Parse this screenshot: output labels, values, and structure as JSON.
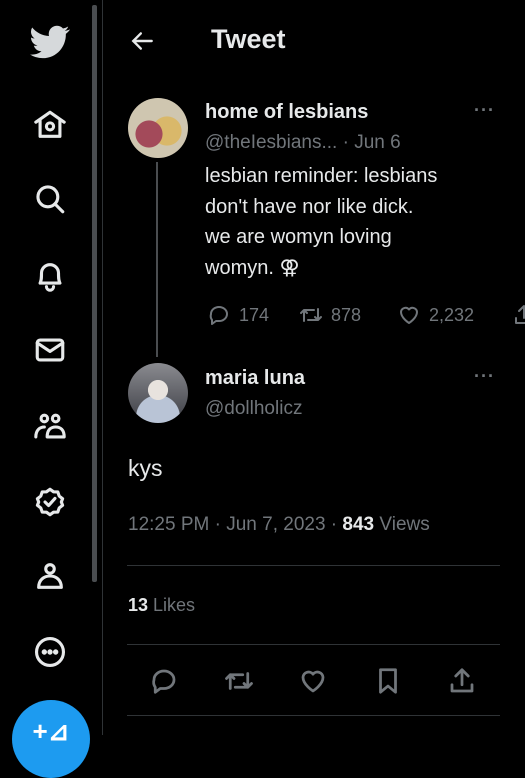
{
  "header": {
    "title": "Tweet"
  },
  "sidebar": {
    "items": [
      "twitter-logo",
      "home",
      "explore",
      "notifications",
      "messages",
      "communities",
      "verified",
      "profile",
      "more",
      "compose"
    ]
  },
  "parent_tweet": {
    "name": "home of lesbians",
    "handle": "@theIesbians...",
    "date": "· Jun 6",
    "lines": [
      "lesbian reminder: lesbians",
      "don't have nor like dick.",
      "we are womyn loving",
      "womyn. ⚢"
    ],
    "replies": "174",
    "retweets": "878",
    "likes": "2,232"
  },
  "tweet": {
    "name": "maria luna",
    "handle": "@dollholicz",
    "text": "kys",
    "time": "12:25 PM · Jun 7, 2023 · ",
    "views_count": "843",
    "views_label": " Views",
    "likes_count": "13",
    "likes_label": " Likes"
  },
  "colors": {
    "accent": "#1d9bf0",
    "background": "#000000",
    "muted": "#71767b"
  }
}
